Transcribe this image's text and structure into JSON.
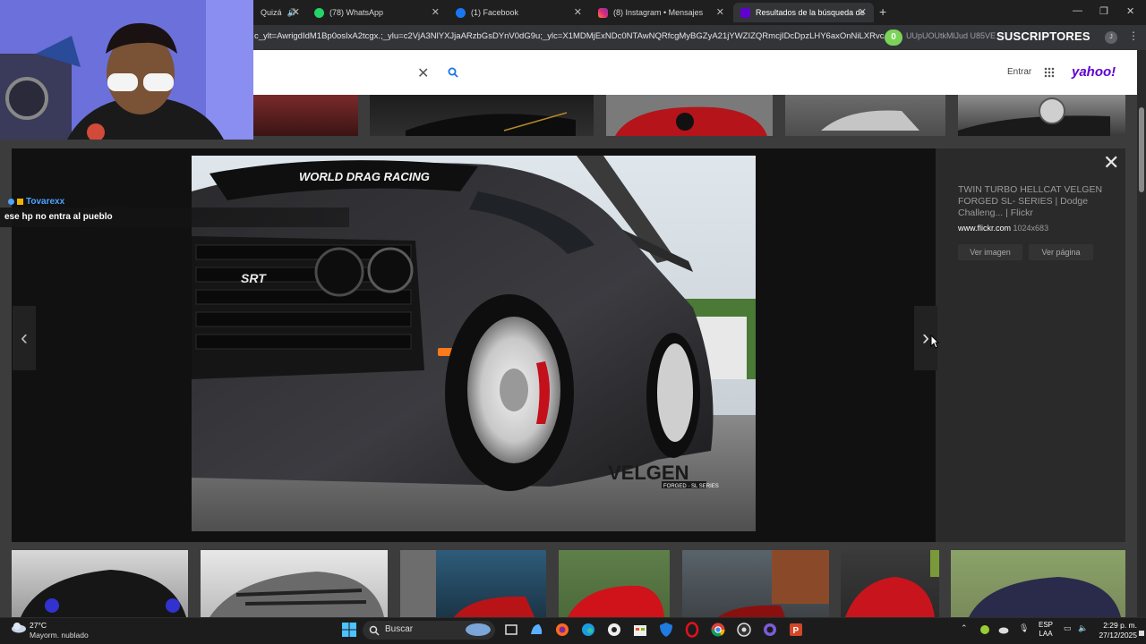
{
  "browser": {
    "tabs": [
      {
        "title": "Quizá",
        "icon": "speaker-icon",
        "color": "#888888"
      },
      {
        "title": "(78) WhatsApp",
        "icon": "whatsapp-icon",
        "color": "#25d366"
      },
      {
        "title": "(1) Facebook",
        "icon": "facebook-icon",
        "color": "#1877f2"
      },
      {
        "title": "(8) Instagram • Mensajes",
        "icon": "instagram-icon",
        "color": "#e1306c"
      },
      {
        "title": "Resultados de la búsqueda de",
        "icon": "yahoo-icon",
        "color": "#6001d2",
        "active": true
      }
    ],
    "url": "c_ylt=AwrigdIdM1Bp0osIxA2tcgx.;_ylu=c2VjA3NlYXJjaARzbGsDYnV0dG9u;_ylc=X1MDMjExNDc0NTAwNQRfcgMyBGZyA21jYWZIZQRmcjIDcDpzLHY6axOnNiLXRvcARncHJpZ",
    "url_tail": "UUpUOUtkMlJud U85VE",
    "subscriber_count": "0",
    "subscriber_label": "SUSCRIPTORES",
    "profile_initial": "J"
  },
  "yahoo": {
    "signin": "Entrar",
    "logo": "yahoo!"
  },
  "lightbox": {
    "title": "TWIN TURBO HELLCAT VELGEN FORGED SL- SERIES | Dodge Challeng... | Flickr",
    "source": "www.flickr.com",
    "dimensions": "1024x683",
    "view_image": "Ver imagen",
    "view_page": "Ver página",
    "overlay_banner": "WORLD DRAG RACING",
    "brand_logo": "VELGEN",
    "brand_sub": "FORGED · SL SERIES",
    "badge": "SRT"
  },
  "chat": {
    "username": "Tovarexx",
    "message": "ese hp no entra al pueblo"
  },
  "taskbar": {
    "temperature": "27°C",
    "weather": "Mayorm. nublado",
    "search_label": "Buscar",
    "lang_top": "ESP",
    "lang_bottom": "LAA",
    "time": "2:29 p. m.",
    "date": "27/12/2025"
  },
  "colors": {
    "yahoo_purple": "#6001d2",
    "chat_name": "#4da3ff",
    "subscriber_green": "#7bd35a"
  }
}
